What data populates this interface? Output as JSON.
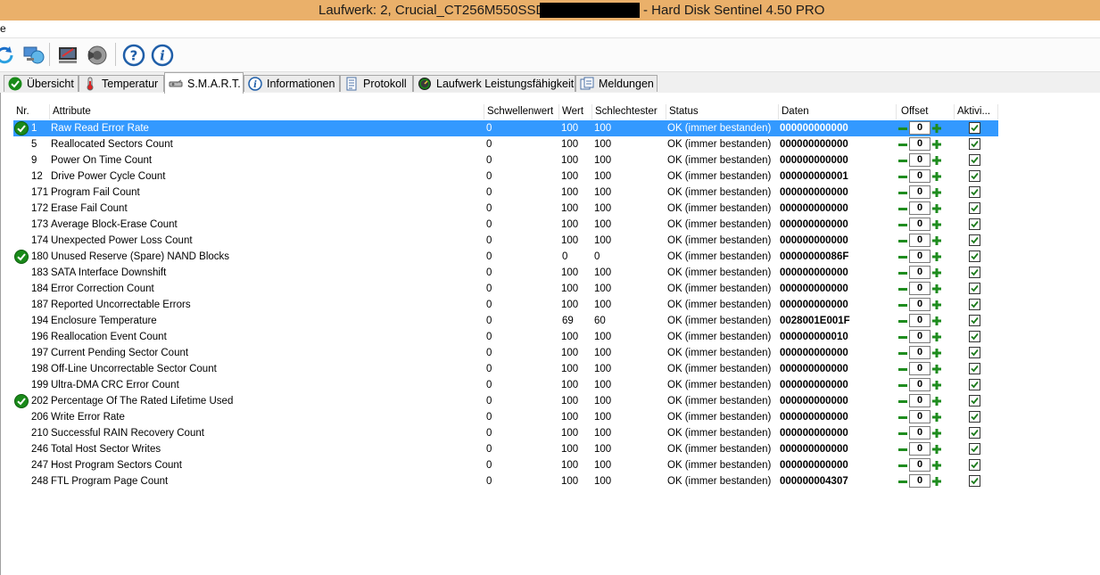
{
  "window": {
    "title_prefix": "Laufwerk: 2, Crucial_CT256M550SSD1",
    "title_suffix": "-  Hard Disk Sentinel 4.50 PRO",
    "titlebar_color": "#eab06a"
  },
  "menu": {
    "first_item": "e"
  },
  "toolbar": {
    "buttons": [
      "refresh-icon",
      "network-icon",
      "report-icon",
      "sound-icon",
      "help-icon",
      "info-icon"
    ]
  },
  "tabs": [
    {
      "label": "Übersicht",
      "icon": "check-icon"
    },
    {
      "label": "Temperatur",
      "icon": "thermometer-icon"
    },
    {
      "label": "S.M.A.R.T.",
      "icon": "smart-icon",
      "active": true
    },
    {
      "label": "Informationen",
      "icon": "info-icon"
    },
    {
      "label": "Protokoll",
      "icon": "log-icon"
    },
    {
      "label": "Laufwerk Leistungsfähigkeit",
      "icon": "gauge-icon"
    },
    {
      "label": "Meldungen",
      "icon": "messages-icon"
    }
  ],
  "table": {
    "columns": [
      "Nr.",
      "Attribute",
      "Schwellenwert",
      "Wert",
      "Schlechtester",
      "Status",
      "Daten",
      "Offset",
      "Aktivi..."
    ],
    "rows": [
      {
        "nr": "1",
        "attribute": "Raw Read Error Rate",
        "threshold": "0",
        "value": "100",
        "worst": "100",
        "status": "OK (immer bestanden)",
        "data": "000000000000",
        "offset": "0",
        "active": true,
        "ok_icon": true,
        "selected": true
      },
      {
        "nr": "5",
        "attribute": "Reallocated Sectors Count",
        "threshold": "0",
        "value": "100",
        "worst": "100",
        "status": "OK (immer bestanden)",
        "data": "000000000000",
        "offset": "0",
        "active": true
      },
      {
        "nr": "9",
        "attribute": "Power On Time Count",
        "threshold": "0",
        "value": "100",
        "worst": "100",
        "status": "OK (immer bestanden)",
        "data": "000000000000",
        "offset": "0",
        "active": true
      },
      {
        "nr": "12",
        "attribute": "Drive Power Cycle Count",
        "threshold": "0",
        "value": "100",
        "worst": "100",
        "status": "OK (immer bestanden)",
        "data": "000000000001",
        "offset": "0",
        "active": true
      },
      {
        "nr": "171",
        "attribute": "Program Fail Count",
        "threshold": "0",
        "value": "100",
        "worst": "100",
        "status": "OK (immer bestanden)",
        "data": "000000000000",
        "offset": "0",
        "active": true
      },
      {
        "nr": "172",
        "attribute": "Erase Fail Count",
        "threshold": "0",
        "value": "100",
        "worst": "100",
        "status": "OK (immer bestanden)",
        "data": "000000000000",
        "offset": "0",
        "active": true
      },
      {
        "nr": "173",
        "attribute": "Average Block-Erase Count",
        "threshold": "0",
        "value": "100",
        "worst": "100",
        "status": "OK (immer bestanden)",
        "data": "000000000000",
        "offset": "0",
        "active": true
      },
      {
        "nr": "174",
        "attribute": "Unexpected Power Loss Count",
        "threshold": "0",
        "value": "100",
        "worst": "100",
        "status": "OK (immer bestanden)",
        "data": "000000000000",
        "offset": "0",
        "active": true
      },
      {
        "nr": "180",
        "attribute": "Unused Reserve (Spare) NAND Blocks",
        "threshold": "0",
        "value": "0",
        "worst": "0",
        "status": "OK (immer bestanden)",
        "data": "00000000086F",
        "offset": "0",
        "active": true,
        "ok_icon": true
      },
      {
        "nr": "183",
        "attribute": "SATA Interface Downshift",
        "threshold": "0",
        "value": "100",
        "worst": "100",
        "status": "OK (immer bestanden)",
        "data": "000000000000",
        "offset": "0",
        "active": true
      },
      {
        "nr": "184",
        "attribute": "Error Correction Count",
        "threshold": "0",
        "value": "100",
        "worst": "100",
        "status": "OK (immer bestanden)",
        "data": "000000000000",
        "offset": "0",
        "active": true
      },
      {
        "nr": "187",
        "attribute": "Reported Uncorrectable Errors",
        "threshold": "0",
        "value": "100",
        "worst": "100",
        "status": "OK (immer bestanden)",
        "data": "000000000000",
        "offset": "0",
        "active": true
      },
      {
        "nr": "194",
        "attribute": "Enclosure Temperature",
        "threshold": "0",
        "value": "69",
        "worst": "60",
        "status": "OK (immer bestanden)",
        "data": "0028001E001F",
        "offset": "0",
        "active": true
      },
      {
        "nr": "196",
        "attribute": "Reallocation Event Count",
        "threshold": "0",
        "value": "100",
        "worst": "100",
        "status": "OK (immer bestanden)",
        "data": "000000000010",
        "offset": "0",
        "active": true
      },
      {
        "nr": "197",
        "attribute": "Current Pending Sector Count",
        "threshold": "0",
        "value": "100",
        "worst": "100",
        "status": "OK (immer bestanden)",
        "data": "000000000000",
        "offset": "0",
        "active": true
      },
      {
        "nr": "198",
        "attribute": "Off-Line Uncorrectable Sector Count",
        "threshold": "0",
        "value": "100",
        "worst": "100",
        "status": "OK (immer bestanden)",
        "data": "000000000000",
        "offset": "0",
        "active": true
      },
      {
        "nr": "199",
        "attribute": "Ultra-DMA CRC Error Count",
        "threshold": "0",
        "value": "100",
        "worst": "100",
        "status": "OK (immer bestanden)",
        "data": "000000000000",
        "offset": "0",
        "active": true
      },
      {
        "nr": "202",
        "attribute": "Percentage Of The Rated Lifetime Used",
        "threshold": "0",
        "value": "100",
        "worst": "100",
        "status": "OK (immer bestanden)",
        "data": "000000000000",
        "offset": "0",
        "active": true,
        "ok_icon": true
      },
      {
        "nr": "206",
        "attribute": "Write Error Rate",
        "threshold": "0",
        "value": "100",
        "worst": "100",
        "status": "OK (immer bestanden)",
        "data": "000000000000",
        "offset": "0",
        "active": true
      },
      {
        "nr": "210",
        "attribute": "Successful RAIN Recovery Count",
        "threshold": "0",
        "value": "100",
        "worst": "100",
        "status": "OK (immer bestanden)",
        "data": "000000000000",
        "offset": "0",
        "active": true
      },
      {
        "nr": "246",
        "attribute": "Total Host Sector Writes",
        "threshold": "0",
        "value": "100",
        "worst": "100",
        "status": "OK (immer bestanden)",
        "data": "000000000000",
        "offset": "0",
        "active": true
      },
      {
        "nr": "247",
        "attribute": "Host Program Sectors Count",
        "threshold": "0",
        "value": "100",
        "worst": "100",
        "status": "OK (immer bestanden)",
        "data": "000000000000",
        "offset": "0",
        "active": true
      },
      {
        "nr": "248",
        "attribute": "FTL Program Page Count",
        "threshold": "0",
        "value": "100",
        "worst": "100",
        "status": "OK (immer bestanden)",
        "data": "000000004307",
        "offset": "0",
        "active": true
      }
    ]
  },
  "colors": {
    "selection": "#3399ff",
    "ok_green": "#1a8a1a",
    "offset_button_green": "#1e8c1e"
  }
}
